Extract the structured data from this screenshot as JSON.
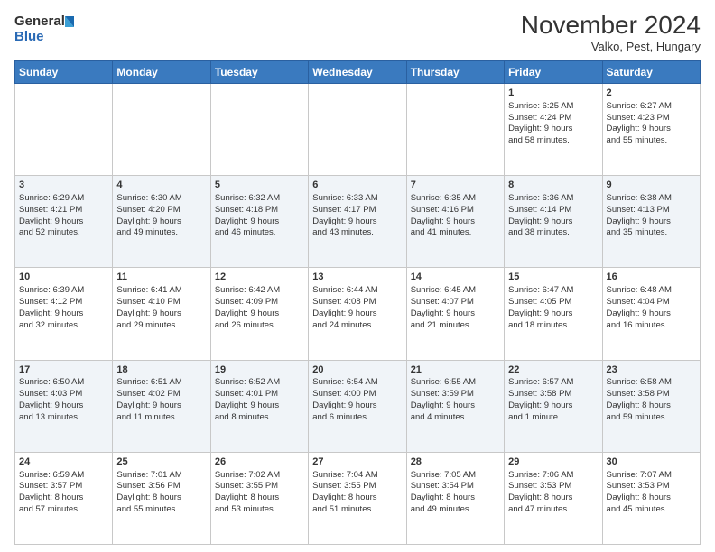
{
  "header": {
    "logo_line1": "General",
    "logo_line2": "Blue",
    "month": "November 2024",
    "location": "Valko, Pest, Hungary"
  },
  "weekdays": [
    "Sunday",
    "Monday",
    "Tuesday",
    "Wednesday",
    "Thursday",
    "Friday",
    "Saturday"
  ],
  "weeks": [
    [
      {
        "day": "",
        "info": ""
      },
      {
        "day": "",
        "info": ""
      },
      {
        "day": "",
        "info": ""
      },
      {
        "day": "",
        "info": ""
      },
      {
        "day": "",
        "info": ""
      },
      {
        "day": "1",
        "info": "Sunrise: 6:25 AM\nSunset: 4:24 PM\nDaylight: 9 hours\nand 58 minutes."
      },
      {
        "day": "2",
        "info": "Sunrise: 6:27 AM\nSunset: 4:23 PM\nDaylight: 9 hours\nand 55 minutes."
      }
    ],
    [
      {
        "day": "3",
        "info": "Sunrise: 6:29 AM\nSunset: 4:21 PM\nDaylight: 9 hours\nand 52 minutes."
      },
      {
        "day": "4",
        "info": "Sunrise: 6:30 AM\nSunset: 4:20 PM\nDaylight: 9 hours\nand 49 minutes."
      },
      {
        "day": "5",
        "info": "Sunrise: 6:32 AM\nSunset: 4:18 PM\nDaylight: 9 hours\nand 46 minutes."
      },
      {
        "day": "6",
        "info": "Sunrise: 6:33 AM\nSunset: 4:17 PM\nDaylight: 9 hours\nand 43 minutes."
      },
      {
        "day": "7",
        "info": "Sunrise: 6:35 AM\nSunset: 4:16 PM\nDaylight: 9 hours\nand 41 minutes."
      },
      {
        "day": "8",
        "info": "Sunrise: 6:36 AM\nSunset: 4:14 PM\nDaylight: 9 hours\nand 38 minutes."
      },
      {
        "day": "9",
        "info": "Sunrise: 6:38 AM\nSunset: 4:13 PM\nDaylight: 9 hours\nand 35 minutes."
      }
    ],
    [
      {
        "day": "10",
        "info": "Sunrise: 6:39 AM\nSunset: 4:12 PM\nDaylight: 9 hours\nand 32 minutes."
      },
      {
        "day": "11",
        "info": "Sunrise: 6:41 AM\nSunset: 4:10 PM\nDaylight: 9 hours\nand 29 minutes."
      },
      {
        "day": "12",
        "info": "Sunrise: 6:42 AM\nSunset: 4:09 PM\nDaylight: 9 hours\nand 26 minutes."
      },
      {
        "day": "13",
        "info": "Sunrise: 6:44 AM\nSunset: 4:08 PM\nDaylight: 9 hours\nand 24 minutes."
      },
      {
        "day": "14",
        "info": "Sunrise: 6:45 AM\nSunset: 4:07 PM\nDaylight: 9 hours\nand 21 minutes."
      },
      {
        "day": "15",
        "info": "Sunrise: 6:47 AM\nSunset: 4:05 PM\nDaylight: 9 hours\nand 18 minutes."
      },
      {
        "day": "16",
        "info": "Sunrise: 6:48 AM\nSunset: 4:04 PM\nDaylight: 9 hours\nand 16 minutes."
      }
    ],
    [
      {
        "day": "17",
        "info": "Sunrise: 6:50 AM\nSunset: 4:03 PM\nDaylight: 9 hours\nand 13 minutes."
      },
      {
        "day": "18",
        "info": "Sunrise: 6:51 AM\nSunset: 4:02 PM\nDaylight: 9 hours\nand 11 minutes."
      },
      {
        "day": "19",
        "info": "Sunrise: 6:52 AM\nSunset: 4:01 PM\nDaylight: 9 hours\nand 8 minutes."
      },
      {
        "day": "20",
        "info": "Sunrise: 6:54 AM\nSunset: 4:00 PM\nDaylight: 9 hours\nand 6 minutes."
      },
      {
        "day": "21",
        "info": "Sunrise: 6:55 AM\nSunset: 3:59 PM\nDaylight: 9 hours\nand 4 minutes."
      },
      {
        "day": "22",
        "info": "Sunrise: 6:57 AM\nSunset: 3:58 PM\nDaylight: 9 hours\nand 1 minute."
      },
      {
        "day": "23",
        "info": "Sunrise: 6:58 AM\nSunset: 3:58 PM\nDaylight: 8 hours\nand 59 minutes."
      }
    ],
    [
      {
        "day": "24",
        "info": "Sunrise: 6:59 AM\nSunset: 3:57 PM\nDaylight: 8 hours\nand 57 minutes."
      },
      {
        "day": "25",
        "info": "Sunrise: 7:01 AM\nSunset: 3:56 PM\nDaylight: 8 hours\nand 55 minutes."
      },
      {
        "day": "26",
        "info": "Sunrise: 7:02 AM\nSunset: 3:55 PM\nDaylight: 8 hours\nand 53 minutes."
      },
      {
        "day": "27",
        "info": "Sunrise: 7:04 AM\nSunset: 3:55 PM\nDaylight: 8 hours\nand 51 minutes."
      },
      {
        "day": "28",
        "info": "Sunrise: 7:05 AM\nSunset: 3:54 PM\nDaylight: 8 hours\nand 49 minutes."
      },
      {
        "day": "29",
        "info": "Sunrise: 7:06 AM\nSunset: 3:53 PM\nDaylight: 8 hours\nand 47 minutes."
      },
      {
        "day": "30",
        "info": "Sunrise: 7:07 AM\nSunset: 3:53 PM\nDaylight: 8 hours\nand 45 minutes."
      }
    ]
  ]
}
